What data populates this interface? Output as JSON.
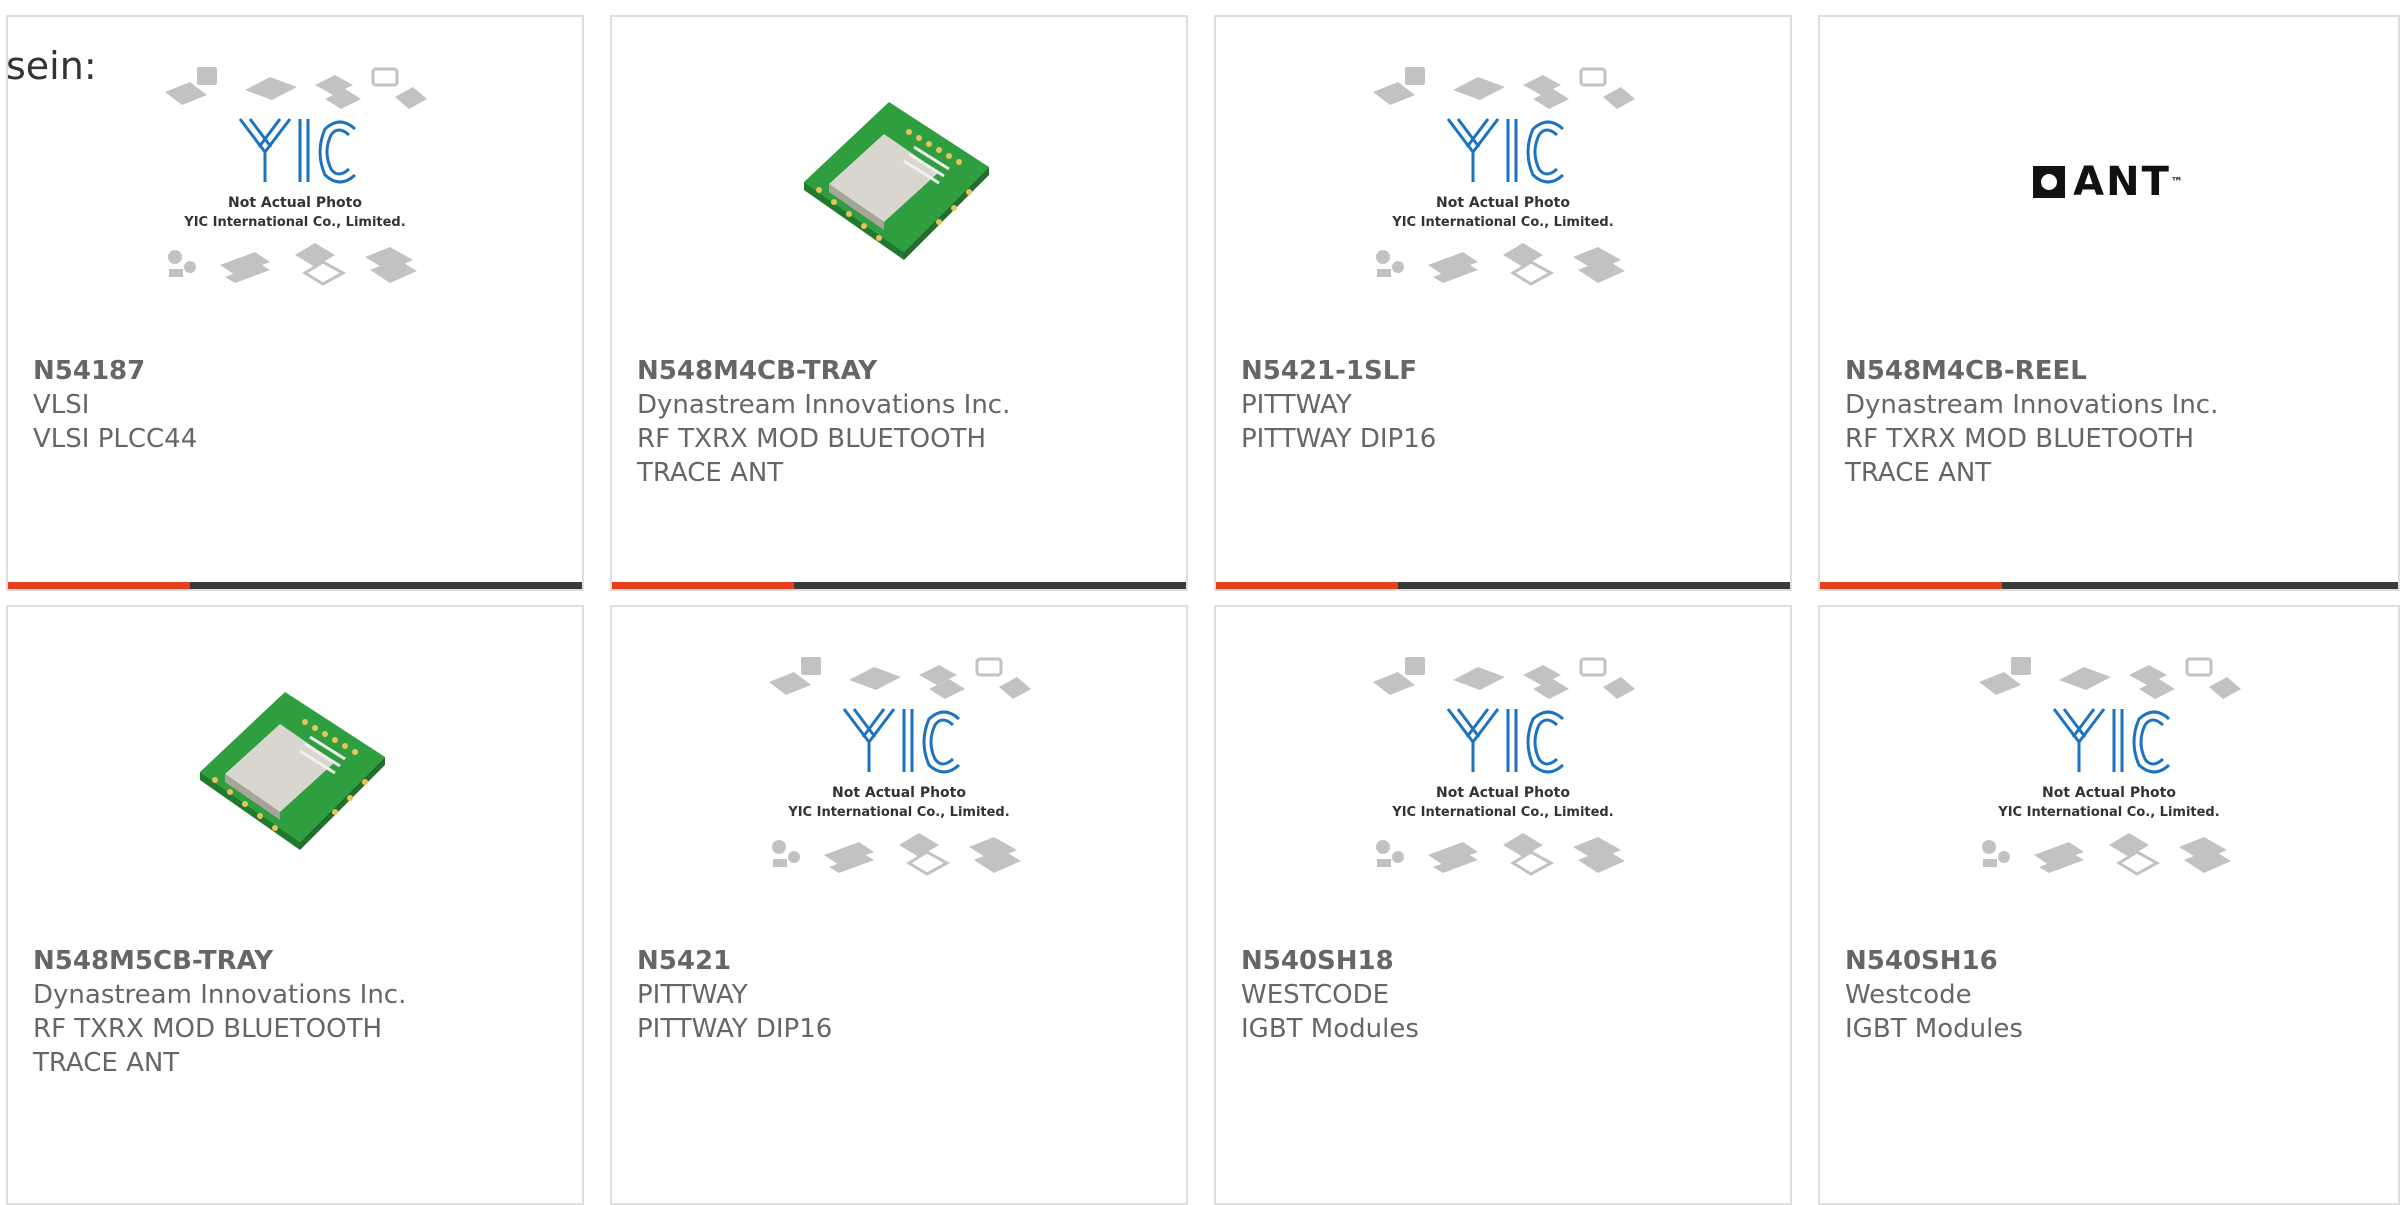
{
  "heading": "sein:",
  "placeholder": {
    "line1": "Not Actual Photo",
    "line2": "YIC International Co., Limited."
  },
  "ant_logo": {
    "text": "ANT",
    "tm": "™"
  },
  "colors": {
    "accent": "#e8401c",
    "bar": "#3a3a3a",
    "text": "#666666",
    "border": "#dedede"
  },
  "products": [
    {
      "part": "N54187",
      "maker": "VLSI",
      "desc": "VLSI PLCC44",
      "image": "placeholder"
    },
    {
      "part": "N548M4CB-TRAY",
      "maker": "Dynastream Innovations Inc.",
      "desc": "RF TXRX MOD BLUETOOTH TRACE ANT",
      "image": "module"
    },
    {
      "part": "N5421-1SLF",
      "maker": "PITTWAY",
      "desc": "PITTWAY DIP16",
      "image": "placeholder"
    },
    {
      "part": "N548M4CB-REEL",
      "maker": "Dynastream Innovations Inc.",
      "desc": "RF TXRX MOD BLUETOOTH TRACE ANT",
      "image": "ant-logo"
    },
    {
      "part": "N548M5CB-TRAY",
      "maker": "Dynastream Innovations Inc.",
      "desc": "RF TXRX MOD BLUETOOTH TRACE ANT",
      "image": "module"
    },
    {
      "part": "N5421",
      "maker": "PITTWAY",
      "desc": "PITTWAY DIP16",
      "image": "placeholder"
    },
    {
      "part": "N540SH18",
      "maker": "WESTCODE",
      "desc": "IGBT Modules",
      "image": "placeholder"
    },
    {
      "part": "N540SH16",
      "maker": "Westcode",
      "desc": "IGBT Modules",
      "image": "placeholder"
    }
  ]
}
